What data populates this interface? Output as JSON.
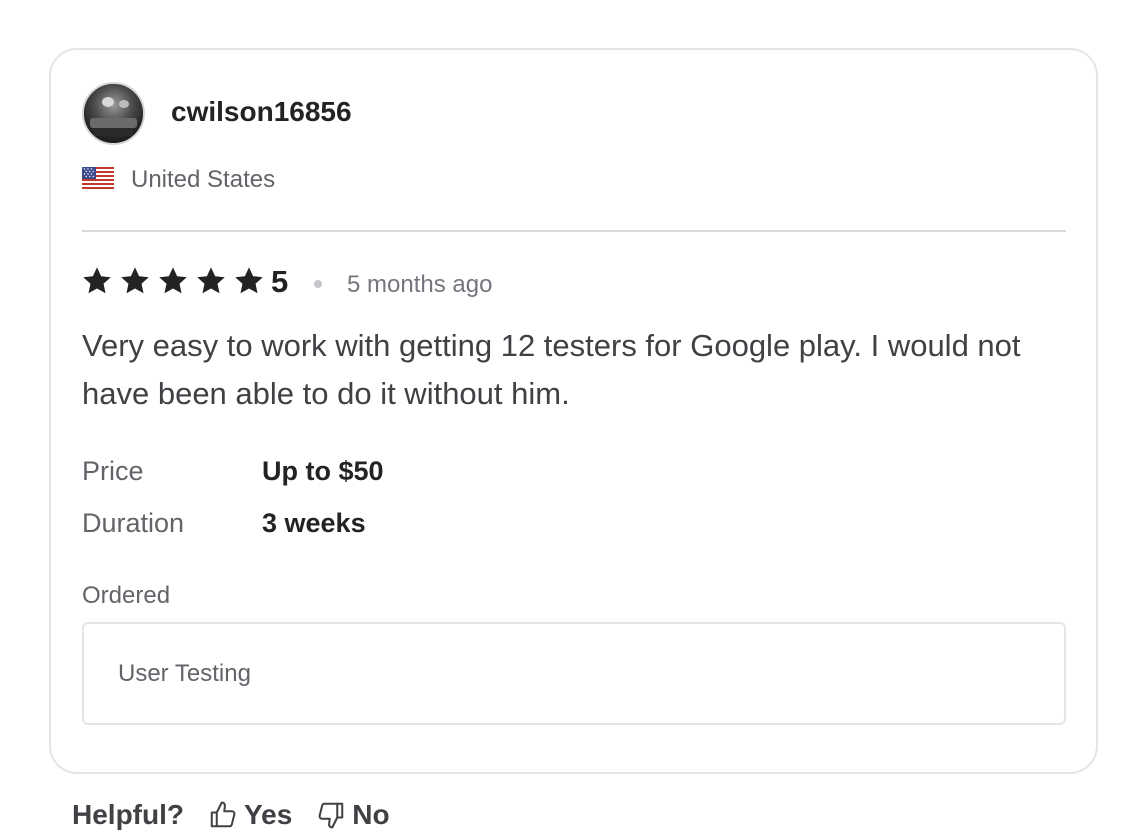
{
  "review": {
    "username": "cwilson16856",
    "country": "United States",
    "flag_icon": "us-flag-icon",
    "rating": "5",
    "rating_stars": 5,
    "time_ago": "5 months ago",
    "text": "Very easy to work with getting 12 testers for Google play. I would not have been able to do it without him.",
    "details": {
      "price_label": "Price",
      "price_value": "Up to $50",
      "duration_label": "Duration",
      "duration_value": "3 weeks"
    },
    "ordered_label": "Ordered",
    "ordered_item": "User Testing"
  },
  "helpful": {
    "label": "Helpful?",
    "yes_label": "Yes",
    "no_label": "No",
    "yes_icon": "thumbs-up-icon",
    "no_icon": "thumbs-down-icon"
  },
  "colors": {
    "text_primary": "#222325",
    "text_secondary": "#62646a",
    "border": "#e4e5e7",
    "star": "#222325"
  }
}
